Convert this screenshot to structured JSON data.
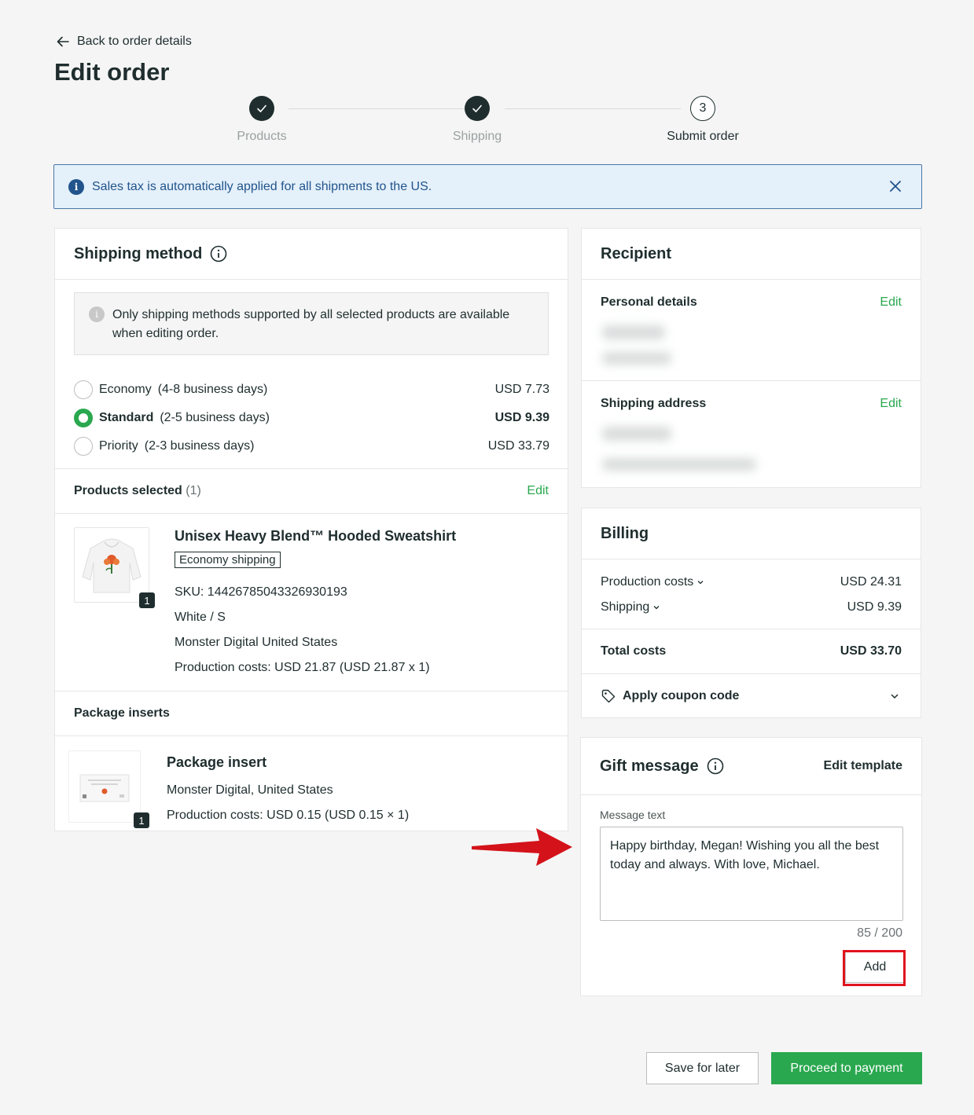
{
  "nav": {
    "back_label": "Back to order details"
  },
  "page": {
    "title": "Edit order"
  },
  "stepper": {
    "steps": [
      {
        "label": "Products",
        "state": "done"
      },
      {
        "label": "Shipping",
        "state": "done"
      },
      {
        "label": "Submit order",
        "state": "current",
        "number": "3"
      }
    ]
  },
  "banner": {
    "text": "Sales tax is automatically applied for all shipments to the US.",
    "icon": "info-icon"
  },
  "shipping_method": {
    "title": "Shipping method",
    "notice": "Only shipping methods supported by all selected products are available when editing order.",
    "options": [
      {
        "name": "Economy",
        "days": "(4-8 business days)",
        "price": "USD 7.73",
        "selected": false
      },
      {
        "name": "Standard",
        "days": "(2-5 business days)",
        "price": "USD 9.39",
        "selected": true
      },
      {
        "name": "Priority",
        "days": "(2-3 business days)",
        "price": "USD 33.79",
        "selected": false
      }
    ]
  },
  "products": {
    "label": "Products selected",
    "count": "(1)",
    "edit_label": "Edit",
    "item": {
      "title": "Unisex Heavy Blend™ Hooded Sweatshirt",
      "tag": "Economy shipping",
      "quantity": "1",
      "sku": "SKU: 14426785043326930193",
      "variant": "White / S",
      "provider": "Monster Digital United States",
      "cost": "Production costs: USD 21.87 (USD 21.87 x 1)"
    }
  },
  "package_inserts": {
    "label": "Package inserts",
    "item": {
      "title": "Package insert",
      "provider": "Monster Digital, United States",
      "cost": "Production costs: USD 0.15 (USD 0.15 × 1)",
      "quantity": "1"
    }
  },
  "recipient": {
    "title": "Recipient",
    "personal_label": "Personal details",
    "address_label": "Shipping address",
    "edit_label": "Edit"
  },
  "billing": {
    "title": "Billing",
    "production_label": "Production costs",
    "production_value": "USD 24.31",
    "shipping_label": "Shipping",
    "shipping_value": "USD 9.39",
    "total_label": "Total costs",
    "total_value": "USD 33.70",
    "coupon_label": "Apply coupon code"
  },
  "gift": {
    "title": "Gift message",
    "edit_template": "Edit template",
    "message_label": "Message text",
    "message": "Happy birthday, Megan! Wishing you all the best today and always. With love, Michael.",
    "counter": "85 / 200",
    "add_label": "Add"
  },
  "footer": {
    "save_label": "Save for later",
    "proceed_label": "Proceed to payment"
  },
  "colors": {
    "accent_green": "#2aa84f",
    "dark": "#1f2d2e",
    "info_blue": "#21548c",
    "highlight_red": "#e0141e"
  }
}
